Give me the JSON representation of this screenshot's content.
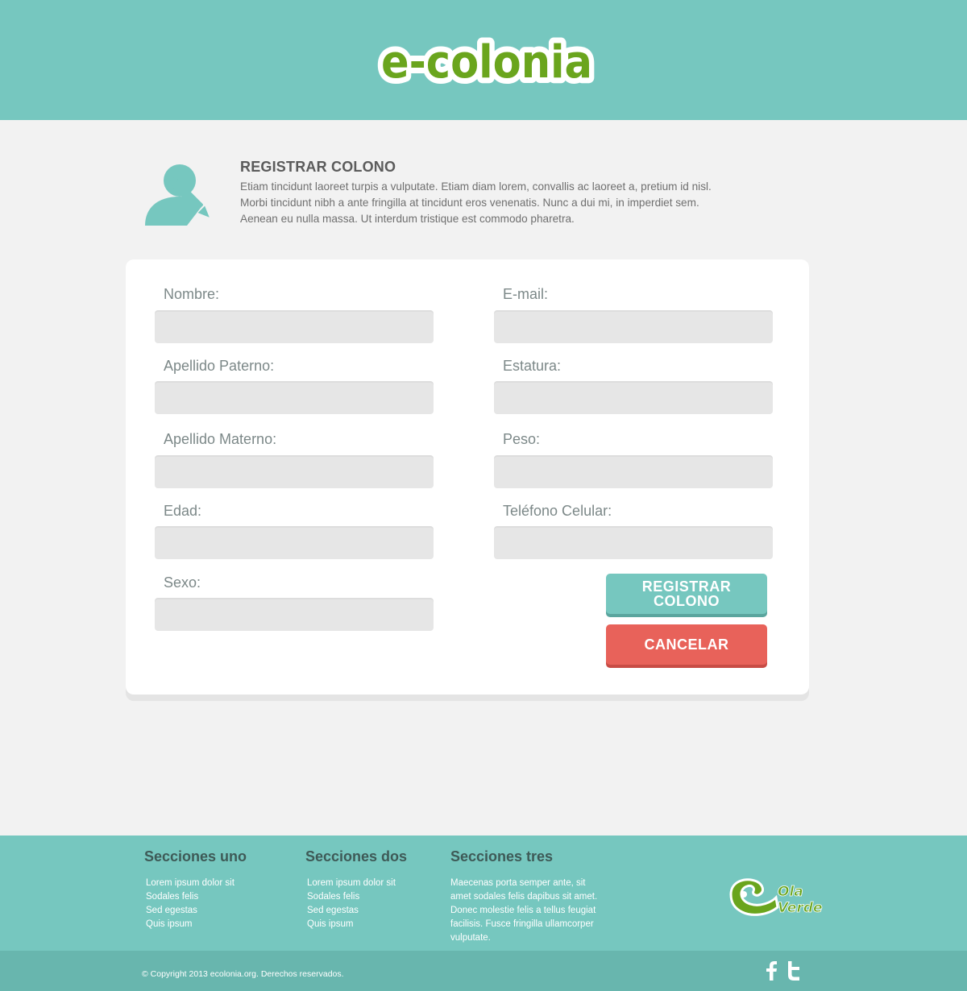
{
  "header": {
    "logo_text": "e-colonia"
  },
  "intro": {
    "icon": "user-edit-icon",
    "title": "REGISTRAR COLONO",
    "description": "Etiam tincidunt laoreet turpis a vulputate. Etiam diam lorem, convallis ac laoreet a, pretium id nisl. Morbi tincidunt nibh a ante fringilla at tincidunt eros venenatis. Nunc a dui mi, in imperdiet sem. Aenean eu nulla massa. Ut interdum tristique est commodo pharetra."
  },
  "form": {
    "nombre": {
      "label": "Nombre:",
      "value": ""
    },
    "apellido_paterno": {
      "label": "Apellido Paterno:",
      "value": ""
    },
    "apellido_materno": {
      "label": "Apellido Materno:",
      "value": ""
    },
    "edad": {
      "label": "Edad:",
      "value": ""
    },
    "sexo": {
      "label": "Sexo:",
      "value": ""
    },
    "email": {
      "label": "E-mail:",
      "value": ""
    },
    "estatura": {
      "label": "Estatura:",
      "value": ""
    },
    "peso": {
      "label": "Peso:",
      "value": ""
    },
    "telefono": {
      "label": "Teléfono Celular:",
      "value": ""
    },
    "register_line1": "REGISTRAR",
    "register_line2": "COLONO",
    "cancel_label": "CANCELAR"
  },
  "footer": {
    "col1": {
      "title": "Secciones uno",
      "items": [
        "Lorem ipsum dolor sit",
        "Sodales felis",
        "Sed egestas",
        "Quis ipsum"
      ]
    },
    "col2": {
      "title": "Secciones dos",
      "items": [
        "Lorem ipsum dolor sit",
        "Sodales felis",
        "Sed egestas",
        "Quis ipsum"
      ]
    },
    "col3": {
      "title": "Secciones tres",
      "text": "Maecenas porta semper ante, sit amet sodales felis dapibus sit amet. Donec molestie felis a tellus feugiat facilisis. Fusce fringilla ullamcorper vulputate."
    },
    "partner_logo": {
      "line1": "Ola",
      "line2": "Verde"
    },
    "copyright": "© Copyright 2013 ecolonia.org. Derechos reservados.",
    "social": [
      "facebook-icon",
      "twitter-icon"
    ]
  },
  "colors": {
    "accent": "#76c7bf",
    "danger": "#e8625a",
    "brand_green": "#6aa51d",
    "background": "#f2f2f2"
  }
}
